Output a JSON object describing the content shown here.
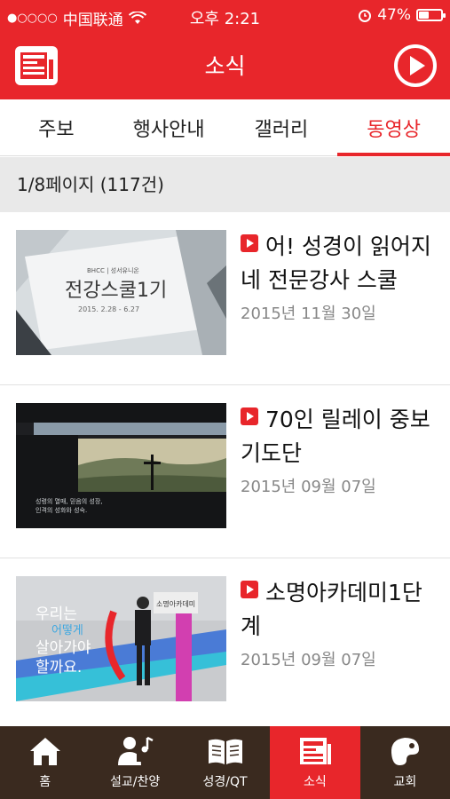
{
  "status_bar": {
    "carrier": "中国联通",
    "signal_dots": "●○○○○",
    "time": "오후 2:21",
    "battery_percent": "47%",
    "battery_level": 0.47
  },
  "header": {
    "title": "소식"
  },
  "tabs": [
    {
      "label": "주보",
      "active": false
    },
    {
      "label": "행사안내",
      "active": false
    },
    {
      "label": "갤러리",
      "active": false
    },
    {
      "label": "동영상",
      "active": true
    }
  ],
  "page_info": "1/8페이지 (117건)",
  "videos": [
    {
      "title": "어! 성경이 읽어지네 전문강사 스쿨",
      "date": "2015년 11월 30일",
      "thumb_text": {
        "line1": "전강스쿨1기",
        "line2": "2015. 2.28 - 6.27",
        "top": "BHCC | 성서유니온"
      }
    },
    {
      "title": "70인 릴레이 중보기도단",
      "date": "2015년 09월 07일",
      "thumb_text": {
        "line1": "성령의 열매, 믿음의 성장,",
        "line2": "인격의 성화와 성숙."
      }
    },
    {
      "title": "소명아카데미1단계",
      "date": "2015년 09월 07일",
      "thumb_text": {
        "line1": "우리는",
        "line2": "어떻게",
        "line3": "살아가야",
        "line4": "할까요.",
        "sign": "소명아카데미"
      }
    }
  ],
  "bottom_tabs": [
    {
      "label": "홈",
      "icon": "home-icon",
      "active": false
    },
    {
      "label": "설교/찬양",
      "icon": "sermon-music-icon",
      "active": false
    },
    {
      "label": "성경/QT",
      "icon": "bible-icon",
      "active": false
    },
    {
      "label": "소식",
      "icon": "news-icon",
      "active": true
    },
    {
      "label": "교회",
      "icon": "church-icon",
      "active": false
    }
  ],
  "colors": {
    "brand_red": "#e8262b",
    "bottom_bar": "#3a2a1f",
    "page_info_bg": "#e9e9e9"
  }
}
